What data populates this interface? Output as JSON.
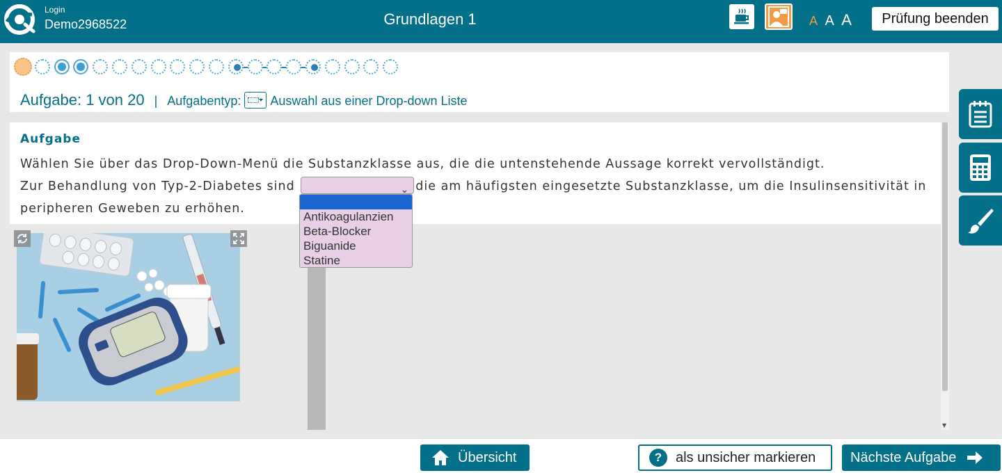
{
  "header": {
    "login_label": "Login",
    "username": "Demo2968522",
    "title": "Grundlagen 1",
    "font_sizes": [
      "A",
      "A",
      "A"
    ],
    "end_exam_label": "Prüfung beenden"
  },
  "progress": {
    "total": 20,
    "current": 1,
    "answered": [
      3,
      4
    ],
    "linked_range": [
      12,
      16
    ],
    "task_label": "Aufgabe: 1 von 20",
    "separator": "|",
    "task_type_label": "Aufgabentyp:",
    "task_type_text": "Auswahl aus einer Drop-down Liste"
  },
  "task": {
    "heading": "Aufgabe",
    "instruction": "Wählen Sie über das Drop-Down-Menü die Substanzklasse aus, die die untenstehende Aussage korrekt vervollständigt.",
    "sentence_before": "Zur Behandlung von Typ-2-Diabetes sind",
    "sentence_after": "die am häufigsten eingesetzte Substanzklasse, um die Insulinsensitivität in",
    "sentence_end": "peripheren Geweben zu erhöhen.",
    "select_value": ""
  },
  "dropdown": {
    "options": [
      "",
      "Antikoagulanzien",
      "Beta-Blocker",
      "Biguanide",
      "Statine"
    ],
    "highlighted_index": 0
  },
  "footer": {
    "overview_label": "Übersicht",
    "unsure_label": "als unsicher markieren",
    "next_label": "Nächste Aufgabe"
  },
  "icons": {
    "coffee": "coffee-break-icon",
    "assist": "support-person-icon",
    "notes": "notepad-icon",
    "calculator": "calculator-icon",
    "brush": "brush-icon"
  },
  "colors": {
    "primary": "#03708a",
    "accent": "#f29b44",
    "select_bg": "#e8cfe6",
    "progress_blue": "#3a9fd6"
  }
}
